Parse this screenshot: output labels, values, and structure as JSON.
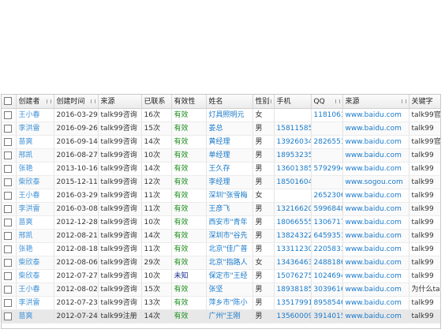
{
  "columns": [
    "创建者",
    "创建时间",
    "来源",
    "已联系",
    "有效性",
    "姓名",
    "性别",
    "手机",
    "QQ",
    "来源",
    "关键字"
  ],
  "rows": [
    {
      "creator": "王小春",
      "date": "2016-03-29",
      "source": "talk99咨询",
      "contacted": "16次",
      "validity": "有效",
      "name": "灯具照明元",
      "gender": "女",
      "phone": "",
      "qq": "1181061",
      "url": "www.baidu.com",
      "keyword": "talk99官"
    },
    {
      "creator": "李洪雷",
      "date": "2016-09-26",
      "source": "talk99咨询",
      "contacted": "15次",
      "validity": "有效",
      "name": "姜总",
      "gender": "男",
      "phone": "15811585",
      "qq": "",
      "url": "www.baidu.com",
      "keyword": "talk99"
    },
    {
      "creator": "苗爽",
      "date": "2016-09-14",
      "source": "talk99咨询",
      "contacted": "14次",
      "validity": "有效",
      "name": "黄经理",
      "gender": "男",
      "phone": "13926034",
      "qq": "2826551",
      "url": "www.baidu.com",
      "keyword": "talk99官"
    },
    {
      "creator": "邢凯",
      "date": "2016-08-27",
      "source": "talk99咨询",
      "contacted": "10次",
      "validity": "有效",
      "name": "单经理",
      "gender": "男",
      "phone": "18953235",
      "qq": "",
      "url": "www.baidu.com",
      "keyword": "talk99"
    },
    {
      "creator": "张艳",
      "date": "2013-10-16",
      "source": "talk99咨询",
      "contacted": "14次",
      "validity": "有效",
      "name": "王久存",
      "gender": "男",
      "phone": "13601385",
      "qq": "5792994",
      "url": "www.baidu.com",
      "keyword": "talk99"
    },
    {
      "creator": "柴欣泰",
      "date": "2015-12-11",
      "source": "talk99咨询",
      "contacted": "12次",
      "validity": "有效",
      "name": "李经理",
      "gender": "男",
      "phone": "18501604",
      "qq": "",
      "url": "www.sogou.com",
      "keyword": "talk99"
    },
    {
      "creator": "王小春",
      "date": "2016-03-29",
      "source": "talk99咨询",
      "contacted": "11次",
      "validity": "有效",
      "name": "深圳\"张雪梅",
      "gender": "女",
      "phone": "",
      "qq": "2652306",
      "url": "www.baidu.com",
      "keyword": "talk99"
    },
    {
      "creator": "李洪雷",
      "date": "2016-03-08",
      "source": "talk99咨询",
      "contacted": "11次",
      "validity": "有效",
      "name": "王彦飞",
      "gender": "男",
      "phone": "13216620",
      "qq": "5996848",
      "url": "www.baidu.com",
      "keyword": "talk99"
    },
    {
      "creator": "苗爽",
      "date": "2012-12-28",
      "source": "talk99咨询",
      "contacted": "10次",
      "validity": "有效",
      "name": "西安市\"青年",
      "gender": "男",
      "phone": "18066555",
      "qq": "1306717",
      "url": "www.baidu.com",
      "keyword": "talk99"
    },
    {
      "creator": "邢凯",
      "date": "2012-08-21",
      "source": "talk99咨询",
      "contacted": "14次",
      "validity": "有效",
      "name": "深圳市\"谷先",
      "gender": "男",
      "phone": "13824322",
      "qq": "6459351",
      "url": "www.baidu.com",
      "keyword": "talk99"
    },
    {
      "creator": "张艳",
      "date": "2012-08-18",
      "source": "talk99咨询",
      "contacted": "11次",
      "validity": "有效",
      "name": "北京\"佳广普",
      "gender": "男",
      "phone": "13311230",
      "qq": "2205831",
      "url": "www.baidu.com",
      "keyword": "talk99"
    },
    {
      "creator": "柴欣泰",
      "date": "2012-08-06",
      "source": "talk99咨询",
      "contacted": "29次",
      "validity": "有效",
      "name": "北京\"指路人",
      "gender": "女",
      "phone": "13436463",
      "qq": "2488186",
      "url": "www.baidu.com",
      "keyword": "talk99"
    },
    {
      "creator": "柴欣泰",
      "date": "2012-07-27",
      "source": "talk99咨询",
      "contacted": "10次",
      "validity": "未知",
      "name": "保定市\"王经",
      "gender": "男",
      "phone": "15076275",
      "qq": "1024694",
      "url": "www.baidu.com",
      "keyword": "talk99"
    },
    {
      "creator": "王小春",
      "date": "2012-08-02",
      "source": "talk99咨询",
      "contacted": "15次",
      "validity": "有效",
      "name": "张坚",
      "gender": "男",
      "phone": "18938185",
      "qq": "3039616",
      "url": "www.baidu.com",
      "keyword": "为什么tal"
    },
    {
      "creator": "李洪雷",
      "date": "2012-07-23",
      "source": "talk99咨询",
      "contacted": "13次",
      "validity": "有效",
      "name": "萍乡市\"陈小",
      "gender": "男",
      "phone": "13517991",
      "qq": "8958546",
      "url": "www.baidu.com",
      "keyword": "talk99"
    },
    {
      "creator": "苗爽",
      "date": "2012-07-24",
      "source": "talk99注册",
      "contacted": "14次",
      "validity": "有效",
      "name": "广州\"王刚",
      "gender": "男",
      "phone": "13560009",
      "qq": "3914015",
      "url": "www.baidu.com",
      "keyword": "talk99"
    }
  ]
}
